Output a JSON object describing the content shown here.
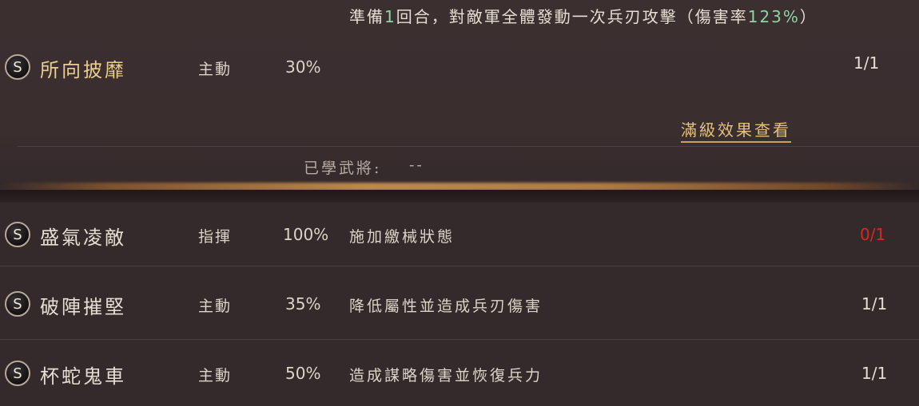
{
  "expanded_skill": {
    "badge": "S",
    "name": "所向披靡",
    "type": "主動",
    "rate": "30%",
    "description_prefix": "準備",
    "description_num1": "1",
    "description_mid": "回合，對敵軍全體發動一次兵刃攻擊（傷害率",
    "description_num2": "123%",
    "description_suffix": "）",
    "count": "1/1",
    "full_level_link": "滿級效果查看",
    "learned_label": "已學武將:",
    "learned_value": "--"
  },
  "skills": [
    {
      "badge": "S",
      "name": "盛氣凌敵",
      "type": "指揮",
      "rate": "100%",
      "description": "施加繳械狀態",
      "count": "0/1",
      "count_color": "#d8281e"
    },
    {
      "badge": "S",
      "name": "破陣摧堅",
      "type": "主動",
      "rate": "35%",
      "description": "降低屬性並造成兵刃傷害",
      "count": "1/1"
    },
    {
      "badge": "S",
      "name": "杯蛇鬼車",
      "type": "主動",
      "rate": "50%",
      "description": "造成謀略傷害並恢復兵力",
      "count": "1/1"
    }
  ],
  "colors": {
    "highlight_green": "#8fd3a6",
    "gold_name": "#e8cf8f",
    "link_gold": "#e3c07c",
    "unavailable_red": "#d8281e"
  }
}
